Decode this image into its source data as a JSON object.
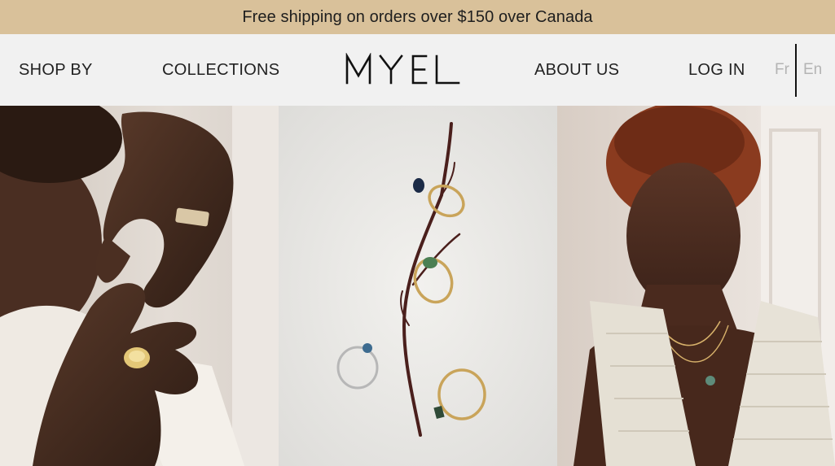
{
  "announcement": "Free shipping on orders over $150 over Canada",
  "nav": {
    "shop_by": "SHOP BY",
    "collections": "COLLECTIONS",
    "about_us": "ABOUT US",
    "log_in": "LOG IN"
  },
  "logo": "MYEL",
  "languages": {
    "fr": "Fr",
    "en": "En"
  },
  "colors": {
    "announcement_bg": "#d9c19a",
    "header_bg": "#f1f1f1",
    "language_inactive": "#b4b4b4"
  },
  "gallery": {
    "images": [
      "hands-with-rings-photo",
      "rings-on-branch-photo",
      "woman-with-necklace-photo"
    ]
  }
}
